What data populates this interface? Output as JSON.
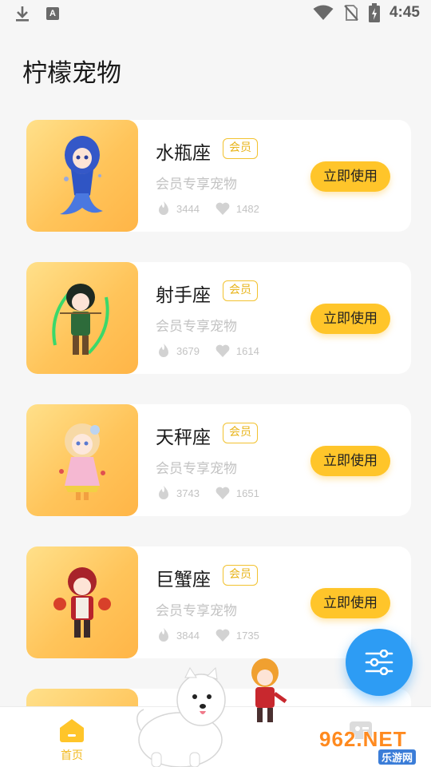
{
  "status_bar": {
    "time": "4:45",
    "a_badge": "A"
  },
  "page": {
    "title": "柠檬宠物"
  },
  "pets": [
    {
      "name": "水瓶座",
      "badge": "会员",
      "desc": "会员专享宠物",
      "hot": "3444",
      "likes": "1482",
      "action": "立即使用"
    },
    {
      "name": "射手座",
      "badge": "会员",
      "desc": "会员专享宠物",
      "hot": "3679",
      "likes": "1614",
      "action": "立即使用"
    },
    {
      "name": "天秤座",
      "badge": "会员",
      "desc": "会员专享宠物",
      "hot": "3743",
      "likes": "1651",
      "action": "立即使用"
    },
    {
      "name": "巨蟹座",
      "badge": "会员",
      "desc": "会员专享宠物",
      "hot": "3844",
      "likes": "1735",
      "action": "立即使用"
    }
  ],
  "bottom_nav": {
    "home_label": "首页"
  },
  "watermark": {
    "main": "962.NET",
    "sub": "乐游网"
  },
  "colors": {
    "accent": "#ffc52a",
    "fab": "#2d9cf4",
    "badge": "#e8b41a"
  },
  "icons": {
    "download": "download-icon",
    "wifi": "wifi-icon",
    "battery": "battery-icon",
    "no_sim": "no-sim-icon",
    "flame": "flame-icon",
    "heart": "heart-icon",
    "filter": "filter-sliders-icon",
    "home": "home-icon"
  }
}
